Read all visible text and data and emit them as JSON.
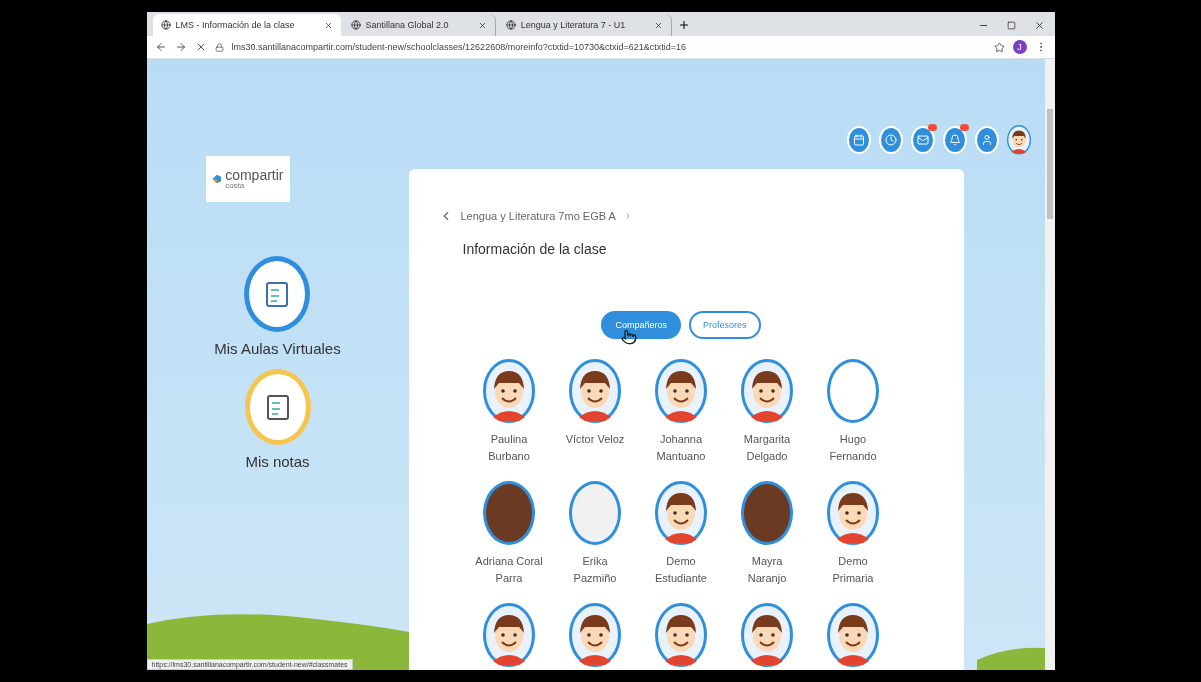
{
  "browser": {
    "tabs": [
      {
        "title": "LMS - Información de la clase",
        "selected": true
      },
      {
        "title": "Santillana Global 2.0",
        "selected": false
      },
      {
        "title": "Lengua y Literatura 7 - U1",
        "selected": false
      }
    ],
    "url": "lms30.santillanacompartir.com/student-new/schoolclasses/12622608/moreinfo?ctxtid=10730&ctxid=621&ctxtid=16",
    "profile_initial": "J",
    "status_url": "https://lms30.santillanacompartir.com/student-new/#classmates"
  },
  "logo": {
    "brand": "compartir",
    "region": "costa"
  },
  "sidebar": {
    "items": [
      {
        "label": "Mis Aulas Virtuales",
        "kind": "classroom",
        "color": "#2f8fdc"
      },
      {
        "label": "Mis notas",
        "kind": "notes",
        "color": "#f5c64e"
      }
    ]
  },
  "toolbar": {
    "icons": [
      {
        "kind": "calendar",
        "badge": false
      },
      {
        "kind": "clock",
        "badge": false
      },
      {
        "kind": "mail",
        "badge": true
      },
      {
        "kind": "bell",
        "badge": true
      },
      {
        "kind": "person",
        "badge": false
      },
      {
        "kind": "avatar",
        "badge": false
      }
    ]
  },
  "card": {
    "breadcrumb": "Lengua y Literatura 7mo EGB A",
    "title": "Información de la clase",
    "toggle": [
      {
        "label": "Compañeros",
        "selected": true
      },
      {
        "label": "Profesores",
        "selected": false
      }
    ],
    "students": [
      {
        "name": "Paulina Burbano",
        "kind": "cartoon"
      },
      {
        "name": "Víctor Veloz",
        "kind": "cartoon"
      },
      {
        "name": "Johanna Mantuano",
        "kind": "cartoon"
      },
      {
        "name": "Margarita Delgado",
        "kind": "cartoon"
      },
      {
        "name": "Hugo Fernando",
        "kind": "empty"
      },
      {
        "name": "Adriana Coral Parra",
        "kind": "photo"
      },
      {
        "name": "Erika Pazmiño",
        "kind": "picture"
      },
      {
        "name": "Demo Estudiante",
        "kind": "cartoon"
      },
      {
        "name": "Mayra Naranjo",
        "kind": "photo"
      },
      {
        "name": "Demo Primaria",
        "kind": "cartoon"
      },
      {
        "kind": "cartoon"
      },
      {
        "kind": "cartoon"
      },
      {
        "kind": "cartoon"
      },
      {
        "kind": "cartoon"
      },
      {
        "kind": "cartoon"
      }
    ]
  }
}
